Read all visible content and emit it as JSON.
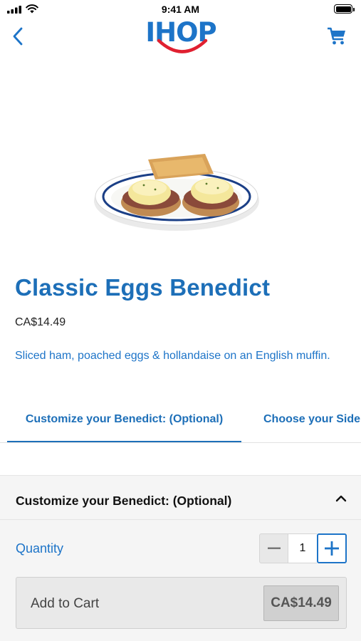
{
  "status_bar": {
    "time": "9:41 AM"
  },
  "brand": {
    "logo_text": "IHOP",
    "accent_color": "#1d74c8",
    "smile_color": "#e02030"
  },
  "nav": {
    "back_icon": "chevron-left-icon",
    "cart_icon": "cart-icon"
  },
  "product": {
    "title": "Classic Eggs Benedict",
    "price": "CA$14.49",
    "description": "Sliced ham, poached eggs & hollandaise on an English muffin."
  },
  "tabs": [
    {
      "label": "Customize your Benedict: (Optional)",
      "active": true
    },
    {
      "label": "Choose your Side",
      "active": false
    }
  ],
  "section": {
    "title": "Customize your Benedict: (Optional)",
    "expanded": true
  },
  "quantity": {
    "label": "Quantity",
    "value": "1"
  },
  "cart_button": {
    "label": "Add to Cart",
    "price": "CA$14.49"
  }
}
